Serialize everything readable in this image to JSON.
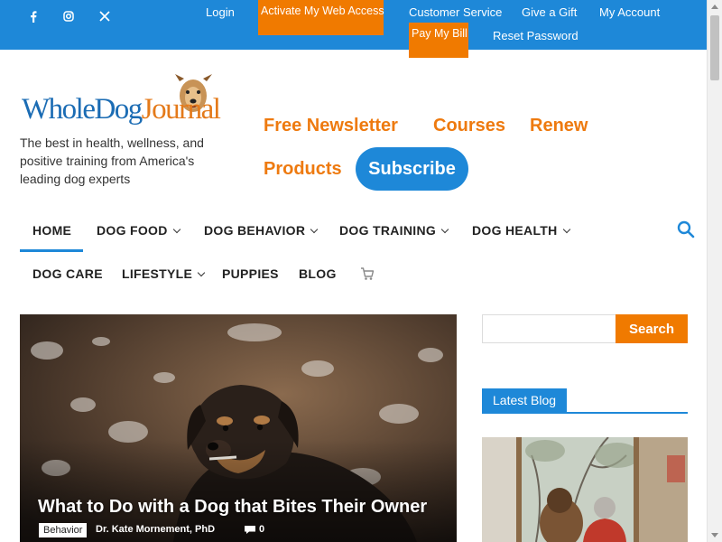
{
  "topbar": {
    "social": [
      {
        "name": "facebook-icon",
        "glyph": "f"
      },
      {
        "name": "instagram-icon",
        "glyph": ""
      },
      {
        "name": "x-icon",
        "glyph": "𝕏"
      }
    ],
    "links": {
      "login": "Login",
      "activate": "Activate My Web Access",
      "customer_service": "Customer Service",
      "give_gift": "Give a Gift",
      "my_account": "My Account",
      "pay_bill": "Pay My Bill",
      "reset_password": "Reset Password"
    },
    "colors": {
      "bar": "#1e88d8",
      "highlight": "#f07a00"
    }
  },
  "header": {
    "logo_word_1": "WholeDog",
    "logo_word_2": "Journal",
    "tagline": "The best in health, wellness, and positive training from America's leading dog experts",
    "links": {
      "newsletter": "Free Newsletter",
      "courses": "Courses",
      "renew": "Renew",
      "products": "Products",
      "subscribe": "Subscribe"
    }
  },
  "mainnav": {
    "home": "HOME",
    "dog_food": "DOG FOOD",
    "dog_behavior": "DOG BEHAVIOR",
    "dog_training": "DOG TRAINING",
    "dog_health": "DOG HEALTH",
    "dog_care": "DOG CARE",
    "lifestyle": "LIFESTYLE",
    "puppies": "PUPPIES",
    "blog": "BLOG"
  },
  "feature": {
    "title": "What to Do with a Dog that Bites Their Owner",
    "category": "Behavior",
    "author": "Dr. Kate Mornement, PhD",
    "comments": "0"
  },
  "sidebar": {
    "search_button": "Search",
    "search_placeholder": "",
    "latest_blog": "Latest Blog"
  }
}
